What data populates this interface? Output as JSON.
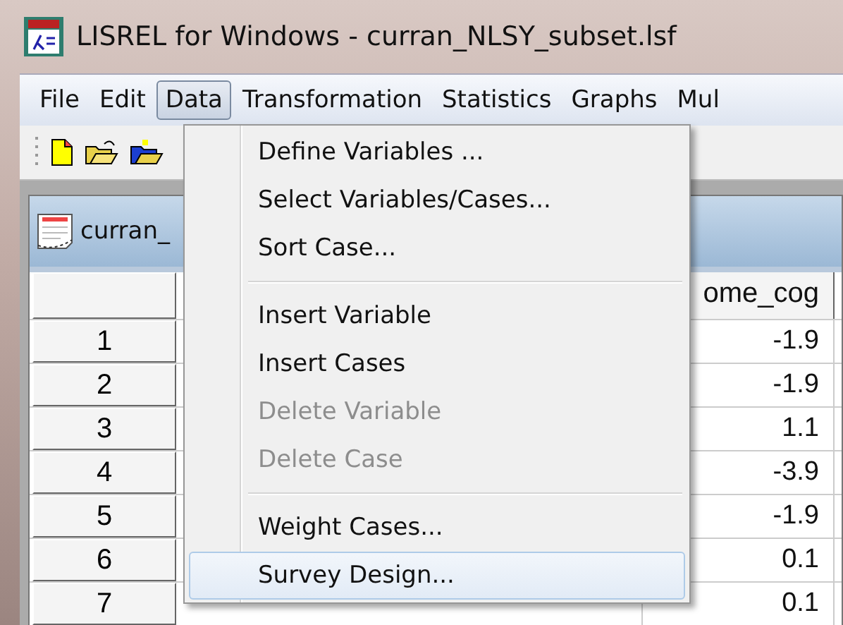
{
  "window": {
    "title": "LISREL for Windows - curran_NLSY_subset.lsf"
  },
  "menu_bar": [
    {
      "label": "File",
      "selected": false
    },
    {
      "label": "Edit",
      "selected": false
    },
    {
      "label": "Data",
      "selected": true
    },
    {
      "label": "Transformation",
      "selected": false
    },
    {
      "label": "Statistics",
      "selected": false
    },
    {
      "label": "Graphs",
      "selected": false
    },
    {
      "label": "Mul",
      "selected": false
    }
  ],
  "data_window": {
    "title": "curran_",
    "column_header": "ome_cog",
    "rows": [
      {
        "header": "1",
        "value": "-1.9"
      },
      {
        "header": "2",
        "value": "-1.9"
      },
      {
        "header": "3",
        "value": "1.1"
      },
      {
        "header": "4",
        "value": "-3.9"
      },
      {
        "header": "5",
        "value": "-1.9"
      },
      {
        "header": "6",
        "value": "0.1"
      },
      {
        "header": "7",
        "value": "0.1"
      }
    ]
  },
  "dropdown": [
    {
      "kind": "item",
      "label": "Define Variables ...",
      "disabled": false,
      "selected": false
    },
    {
      "kind": "item",
      "label": "Select Variables/Cases...",
      "disabled": false,
      "selected": false
    },
    {
      "kind": "item",
      "label": "Sort Case...",
      "disabled": false,
      "selected": false
    },
    {
      "kind": "separator"
    },
    {
      "kind": "item",
      "label": "Insert Variable",
      "disabled": false,
      "selected": false
    },
    {
      "kind": "item",
      "label": "Insert Cases",
      "disabled": false,
      "selected": false
    },
    {
      "kind": "item",
      "label": "Delete Variable",
      "disabled": true,
      "selected": false
    },
    {
      "kind": "item",
      "label": "Delete Case",
      "disabled": true,
      "selected": false
    },
    {
      "kind": "separator"
    },
    {
      "kind": "item",
      "label": "Weight Cases...",
      "disabled": false,
      "selected": false
    },
    {
      "kind": "item",
      "label": "Survey Design...",
      "disabled": false,
      "selected": true
    }
  ]
}
